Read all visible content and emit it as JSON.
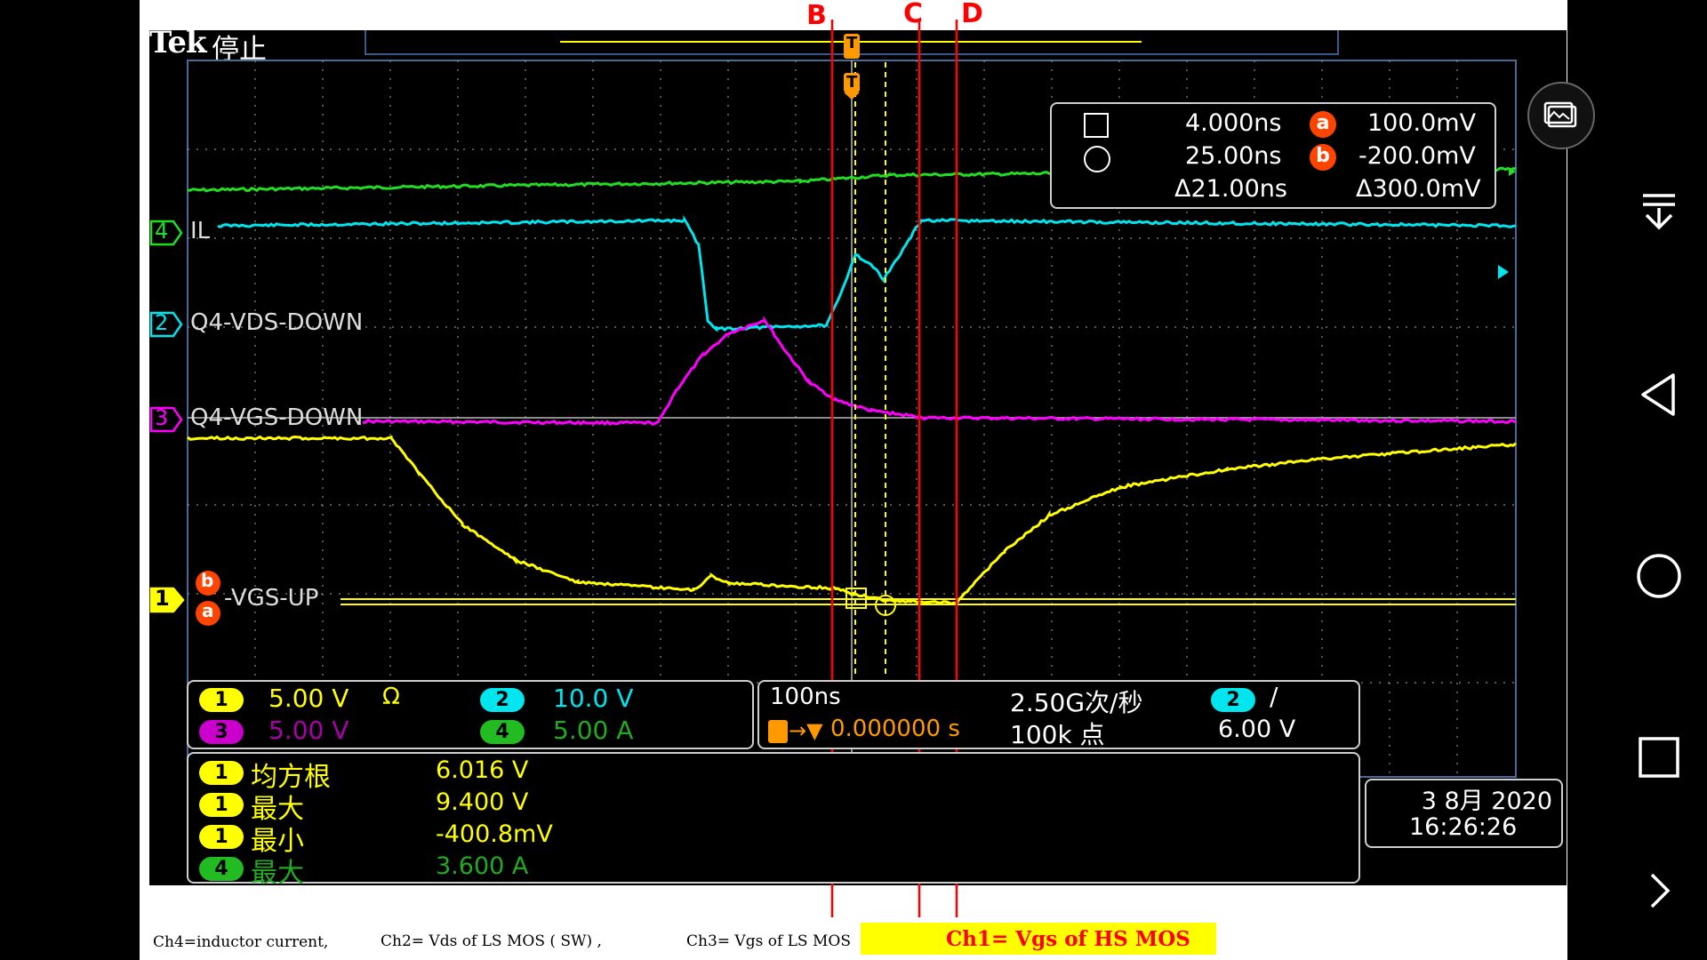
{
  "scope": {
    "brand": "Tek",
    "run_state": "停止",
    "cursor_labels": [
      "B",
      "C",
      "D"
    ],
    "channel_labels": {
      "ch4": "IL",
      "ch2": "Q4-VDS-DOWN",
      "ch3": "Q4-VGS-DOWN",
      "ch1": "-VGS-UP"
    },
    "channel_numbers": {
      "ch1": "1",
      "ch2": "2",
      "ch3": "3",
      "ch4": "4"
    },
    "cursor_markers": {
      "a": "a",
      "b": "b",
      "trigger": "T"
    },
    "cursor_readout": {
      "time1": "4.000ns",
      "time2": "25.00ns",
      "dtime": "Δ21.00ns",
      "v_a": "100.0mV",
      "v_b": "-200.0mV",
      "dv": "Δ300.0mV",
      "label_a": "a",
      "label_b": "b"
    },
    "vertical": {
      "ch1": "5.00 V",
      "ch1_symbol": "Ω",
      "ch2": "10.0 V",
      "ch3": "5.00 V",
      "ch4": "5.00 A"
    },
    "horizontal": {
      "timebase": "100ns",
      "sample_rate": "2.50G次/秒",
      "record_length": "100k 点",
      "trigger_pos": "0.000000 s",
      "trigger_level": "6.00 V",
      "trigger_slope": "/"
    },
    "measurements": [
      {
        "ch": "1",
        "name": "均方根",
        "value": "6.016 V",
        "color": "#ffff00"
      },
      {
        "ch": "1",
        "name": "最大",
        "value": "9.400 V",
        "color": "#ffff00"
      },
      {
        "ch": "1",
        "name": "最小",
        "value": "-400.8mV",
        "color": "#ffff00"
      },
      {
        "ch": "4",
        "name": "最大",
        "value": "3.600 A",
        "color": "#22cc22"
      }
    ],
    "datetime": {
      "date": "3 8月 2020",
      "time": "16:26:26"
    },
    "colors": {
      "ch1": "#ffff00",
      "ch2": "#00e5ee",
      "ch3": "#ff00ff",
      "ch4": "#22dd22",
      "annotation": "#ff0000",
      "cursor_marker": "#ff4400",
      "trigger": "#ff9900"
    }
  },
  "notes": {
    "ch4": "Ch4=inductor current,",
    "ch2": "Ch2= Vds of LS MOS ( SW) ,",
    "ch3": "Ch3= Vgs of LS MOS",
    "ch1": "Ch1= Vgs of HS MOS"
  },
  "nav": {
    "gallery": "gallery-icon",
    "menu_down": "collapse-menu-icon",
    "back": "back-icon",
    "home": "home-icon",
    "recents": "recents-icon",
    "next": "next-icon"
  }
}
